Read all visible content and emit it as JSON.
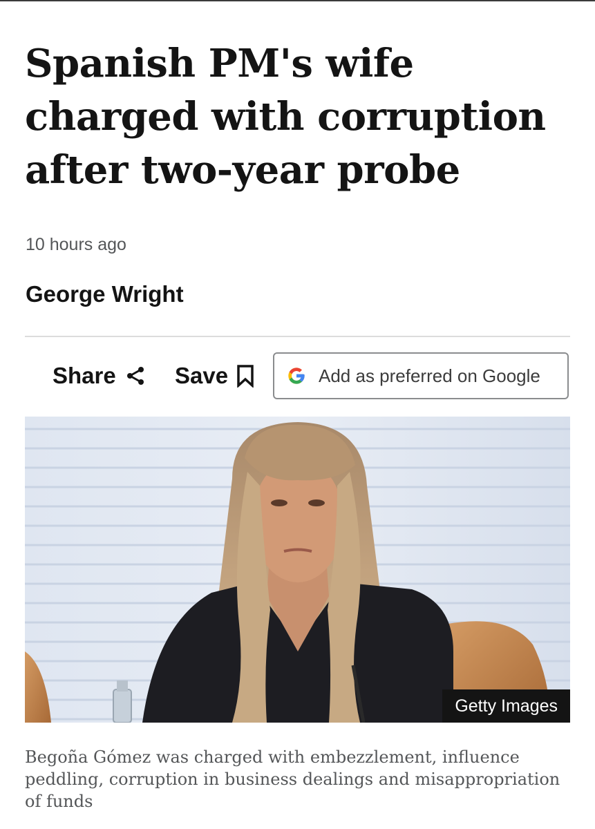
{
  "article": {
    "headline": "Spanish PM's wife charged with corruption after two-year probe",
    "timestamp": "10 hours ago",
    "author": "George Wright"
  },
  "actions": {
    "share_label": "Share",
    "save_label": "Save",
    "google_preferred_label": "Add as preferred on Google"
  },
  "hero": {
    "credit": "Getty Images",
    "caption": "Begoña Gómez was charged with embezzlement, influence peddling, corruption in business dealings and misappropriation of funds"
  },
  "icons": {
    "share": "share-icon",
    "save": "bookmark-icon",
    "google": "google-g-icon"
  },
  "colors": {
    "text": "#141414",
    "muted_text": "#545658",
    "google_blue": "#4285F4",
    "google_red": "#EA4335",
    "google_yellow": "#FBBC05",
    "google_green": "#34A853"
  }
}
